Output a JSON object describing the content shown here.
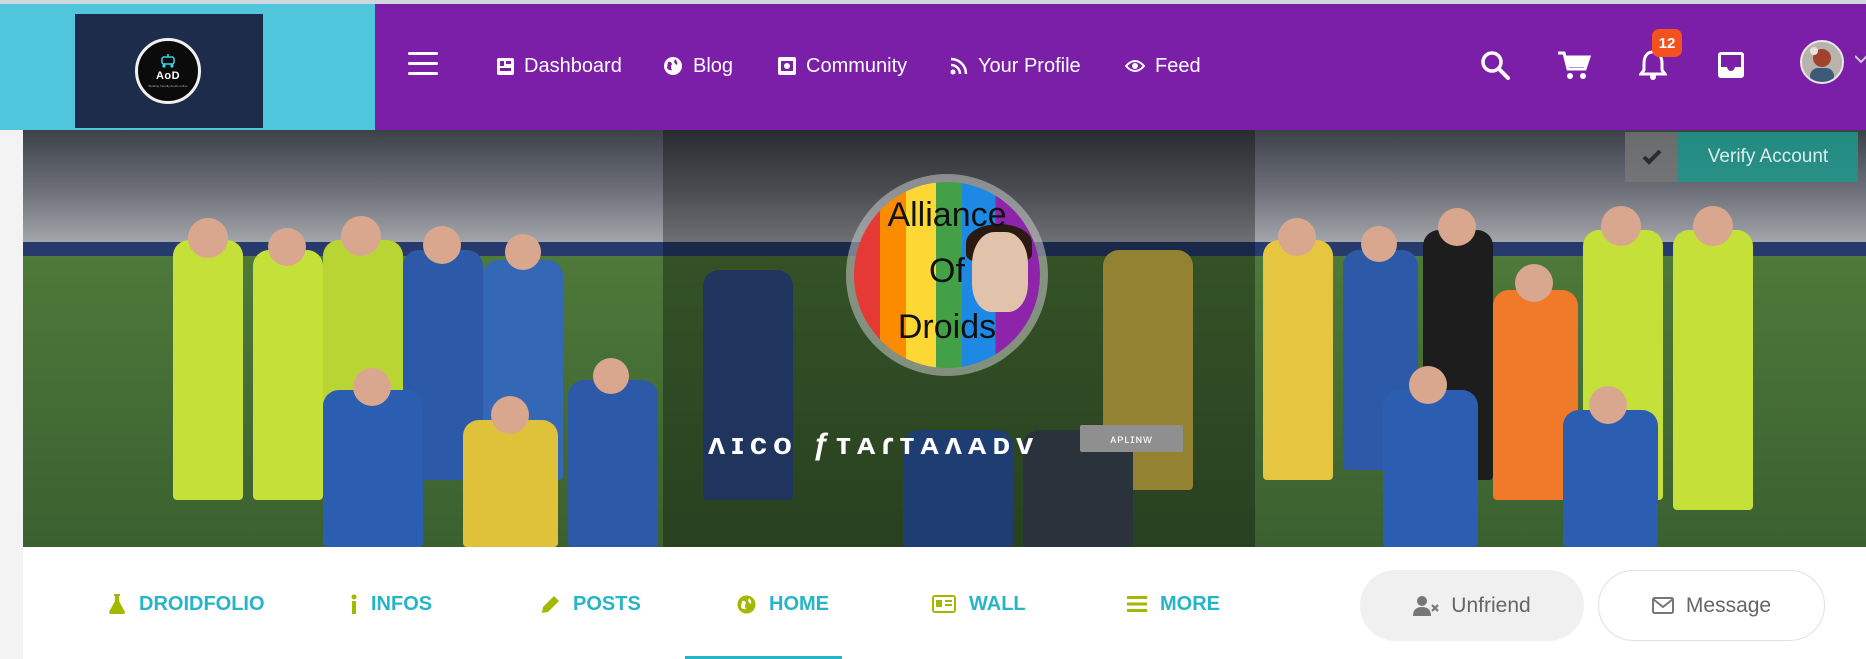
{
  "logo": {
    "title": "AoD",
    "subtitle": "Building friendly droids online"
  },
  "nav": {
    "items": [
      {
        "label": "Dashboard",
        "icon": "dashboard-icon"
      },
      {
        "label": "Blog",
        "icon": "globe-icon"
      },
      {
        "label": "Community",
        "icon": "image-icon"
      },
      {
        "label": "Your Profile",
        "icon": "rss-icon"
      },
      {
        "label": "Feed",
        "icon": "eye-icon"
      }
    ],
    "notifications_count": "12"
  },
  "cover": {
    "profile_logo_lines": [
      "Alliance",
      "Of",
      "Droids"
    ],
    "name": "ʌɪᴄᴏ ƒᴛᴀɾᴛᴀʌᴀᴅᴠ",
    "tag": "ᴀᴘʟɪɴᴡ",
    "verify_label": "Verify Account"
  },
  "tabs": [
    {
      "label": "DROIDFOLIO",
      "icon": "flask-icon",
      "color": "#a3b800"
    },
    {
      "label": "INFOS",
      "icon": "info-icon",
      "color": "#a3b800"
    },
    {
      "label": "POSTS",
      "icon": "pencil-icon",
      "color": "#a3b800"
    },
    {
      "label": "HOME",
      "icon": "globe-icon",
      "color": "#a3b800",
      "active": true
    },
    {
      "label": "WALL",
      "icon": "id-card-icon",
      "color": "#a3b800"
    },
    {
      "label": "MORE",
      "icon": "list-icon",
      "color": "#a3b800"
    }
  ],
  "actions": {
    "unfriend": "Unfriend",
    "message": "Message"
  },
  "colors": {
    "header": "#7b1fa8",
    "logo_bg": "#4fc6dc",
    "tab_text": "#26b5c6",
    "tab_icon": "#a3b800",
    "badge": "#f4511e"
  }
}
